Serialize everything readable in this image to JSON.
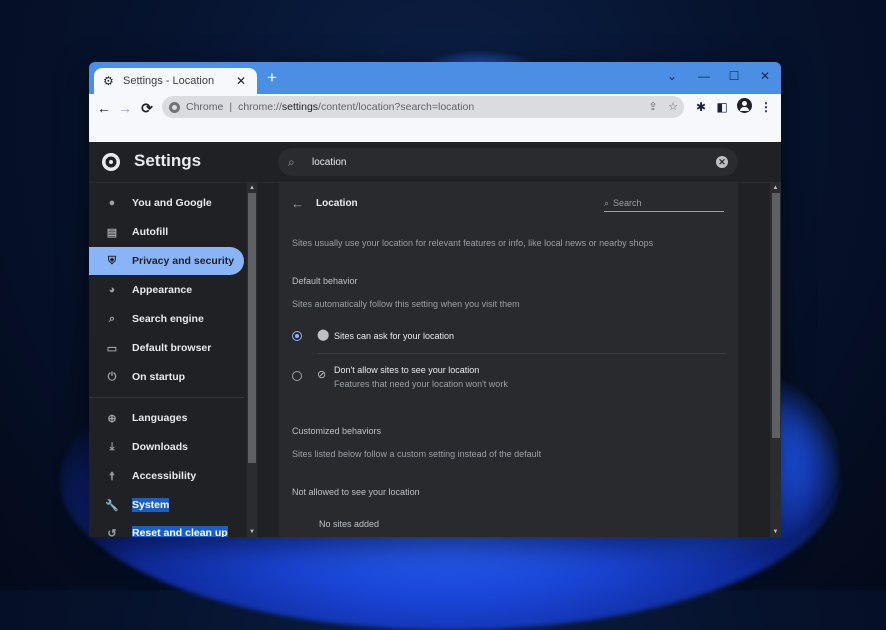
{
  "browser": {
    "tab": {
      "title": "Settings - Location",
      "favicon": "gear-icon"
    },
    "new_tab_symbol": "+",
    "window_controls": {
      "tab_search": "⌄",
      "minimize": "—",
      "maximize": "☐",
      "close": "✕"
    },
    "nav": {
      "back": "←",
      "forward": "→",
      "reload": "⟳"
    },
    "omnibox": {
      "site_label": "Chrome",
      "separator": "|",
      "url_prefix": "chrome://",
      "url_host": "settings",
      "url_path": "/content/location?search=location"
    },
    "toolbar_icons": {
      "share": "⇪",
      "bookmark": "☆",
      "extensions": "✱",
      "side_panel": "◧",
      "menu": "⋮"
    }
  },
  "settings": {
    "title": "Settings",
    "search": {
      "value": "location",
      "clear": "✕",
      "icon": "⌕"
    },
    "sidebar": {
      "items": [
        {
          "label": "You and Google",
          "icon": "person-icon",
          "glyph": "👤"
        },
        {
          "label": "Autofill",
          "icon": "clipboard-icon",
          "glyph": "📋"
        },
        {
          "label": "Privacy and security",
          "icon": "shield-icon",
          "glyph": "⛨",
          "active": true
        },
        {
          "label": "Appearance",
          "icon": "palette-icon",
          "glyph": "🎨"
        },
        {
          "label": "Search engine",
          "icon": "search-icon",
          "glyph": "⌕"
        },
        {
          "label": "Default browser",
          "icon": "browser-icon",
          "glyph": "▭"
        },
        {
          "label": "On startup",
          "icon": "power-icon",
          "glyph": "⏻"
        },
        {
          "label": "Languages",
          "icon": "globe-icon",
          "glyph": "🌐"
        },
        {
          "label": "Downloads",
          "icon": "download-icon",
          "glyph": "⤓"
        },
        {
          "label": "Accessibility",
          "icon": "accessibility-icon",
          "glyph": "🕴"
        },
        {
          "label": "System",
          "icon": "wrench-icon",
          "glyph": "🔧",
          "highlighted": true
        },
        {
          "label": "Reset and clean up",
          "icon": "history-icon",
          "glyph": "↺",
          "highlighted": true
        }
      ]
    },
    "location_page": {
      "back_glyph": "←",
      "title": "Location",
      "search_placeholder": "Search",
      "search_glyph": "⌕",
      "description": "Sites usually use your location for relevant features or info, like local news or nearby shops",
      "default_behavior": {
        "heading": "Default behavior",
        "subtitle": "Sites automatically follow this setting when you visit them",
        "options": [
          {
            "label": "Sites can ask for your location",
            "selected": true,
            "icon": "location-pin-icon",
            "glyph": "📍"
          },
          {
            "label": "Don't allow sites to see your location",
            "sublabel": "Features that need your location won't work",
            "selected": false,
            "icon": "location-off-icon",
            "glyph": "⊘"
          }
        ]
      },
      "customized_behaviors": {
        "heading": "Customized behaviors",
        "subtitle": "Sites listed below follow a custom setting instead of the default",
        "not_allowed_heading": "Not allowed to see your location",
        "empty_text": "No sites added"
      }
    }
  }
}
